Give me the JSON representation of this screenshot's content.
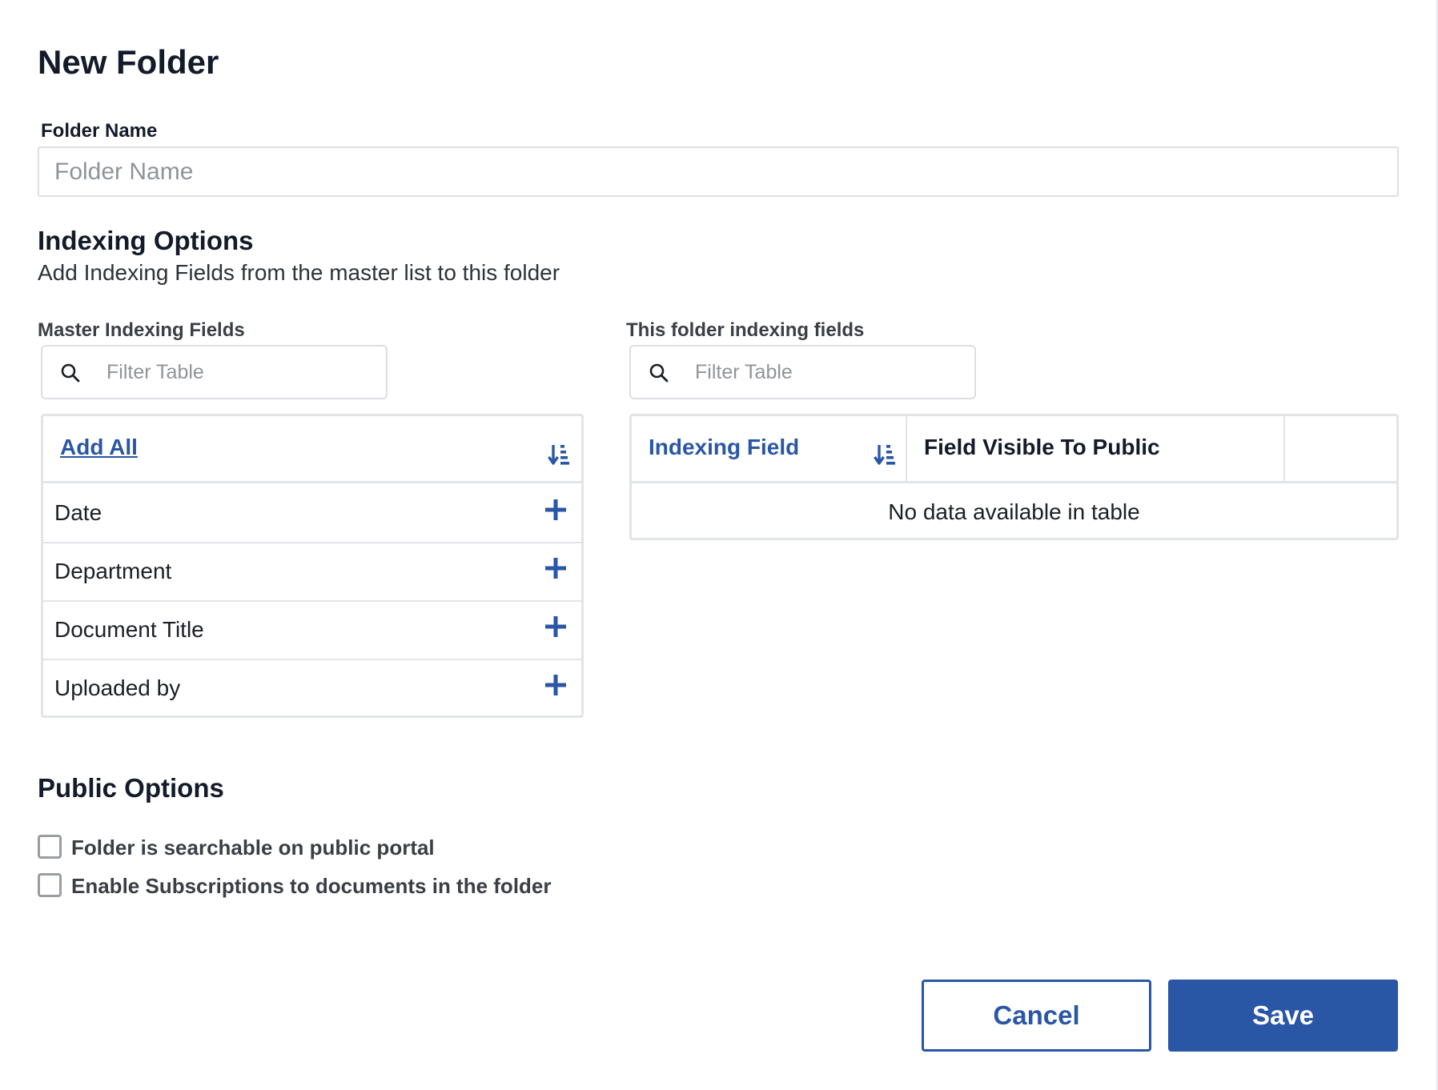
{
  "dialog": {
    "title": "New Folder"
  },
  "folder_name": {
    "label": "Folder Name",
    "placeholder": "Folder Name",
    "value": ""
  },
  "indexing": {
    "heading": "Indexing Options",
    "description": "Add Indexing Fields from the master list to this folder",
    "master": {
      "label": "Master Indexing Fields",
      "filter_placeholder": "Filter Table",
      "add_all_label": "Add All",
      "rows": [
        {
          "label": "Date"
        },
        {
          "label": "Department"
        },
        {
          "label": "Document Title"
        },
        {
          "label": "Uploaded by"
        }
      ]
    },
    "folder": {
      "label": "This folder indexing fields",
      "filter_placeholder": "Filter Table",
      "columns": [
        "Indexing Field",
        "Field Visible To Public",
        ""
      ],
      "empty_message": "No data available in table"
    }
  },
  "public_options": {
    "heading": "Public Options",
    "options": [
      {
        "label": "Folder is searchable on public portal",
        "checked": false
      },
      {
        "label": "Enable Subscriptions to documents in the folder",
        "checked": false
      }
    ]
  },
  "actions": {
    "cancel_label": "Cancel",
    "save_label": "Save"
  },
  "colors": {
    "accent": "#2a56a6",
    "border": "#e1e4e8",
    "text": "#1b1f27"
  },
  "icons": {
    "search": "search-icon",
    "sort": "sort-amount-down-icon",
    "add": "plus-icon"
  }
}
